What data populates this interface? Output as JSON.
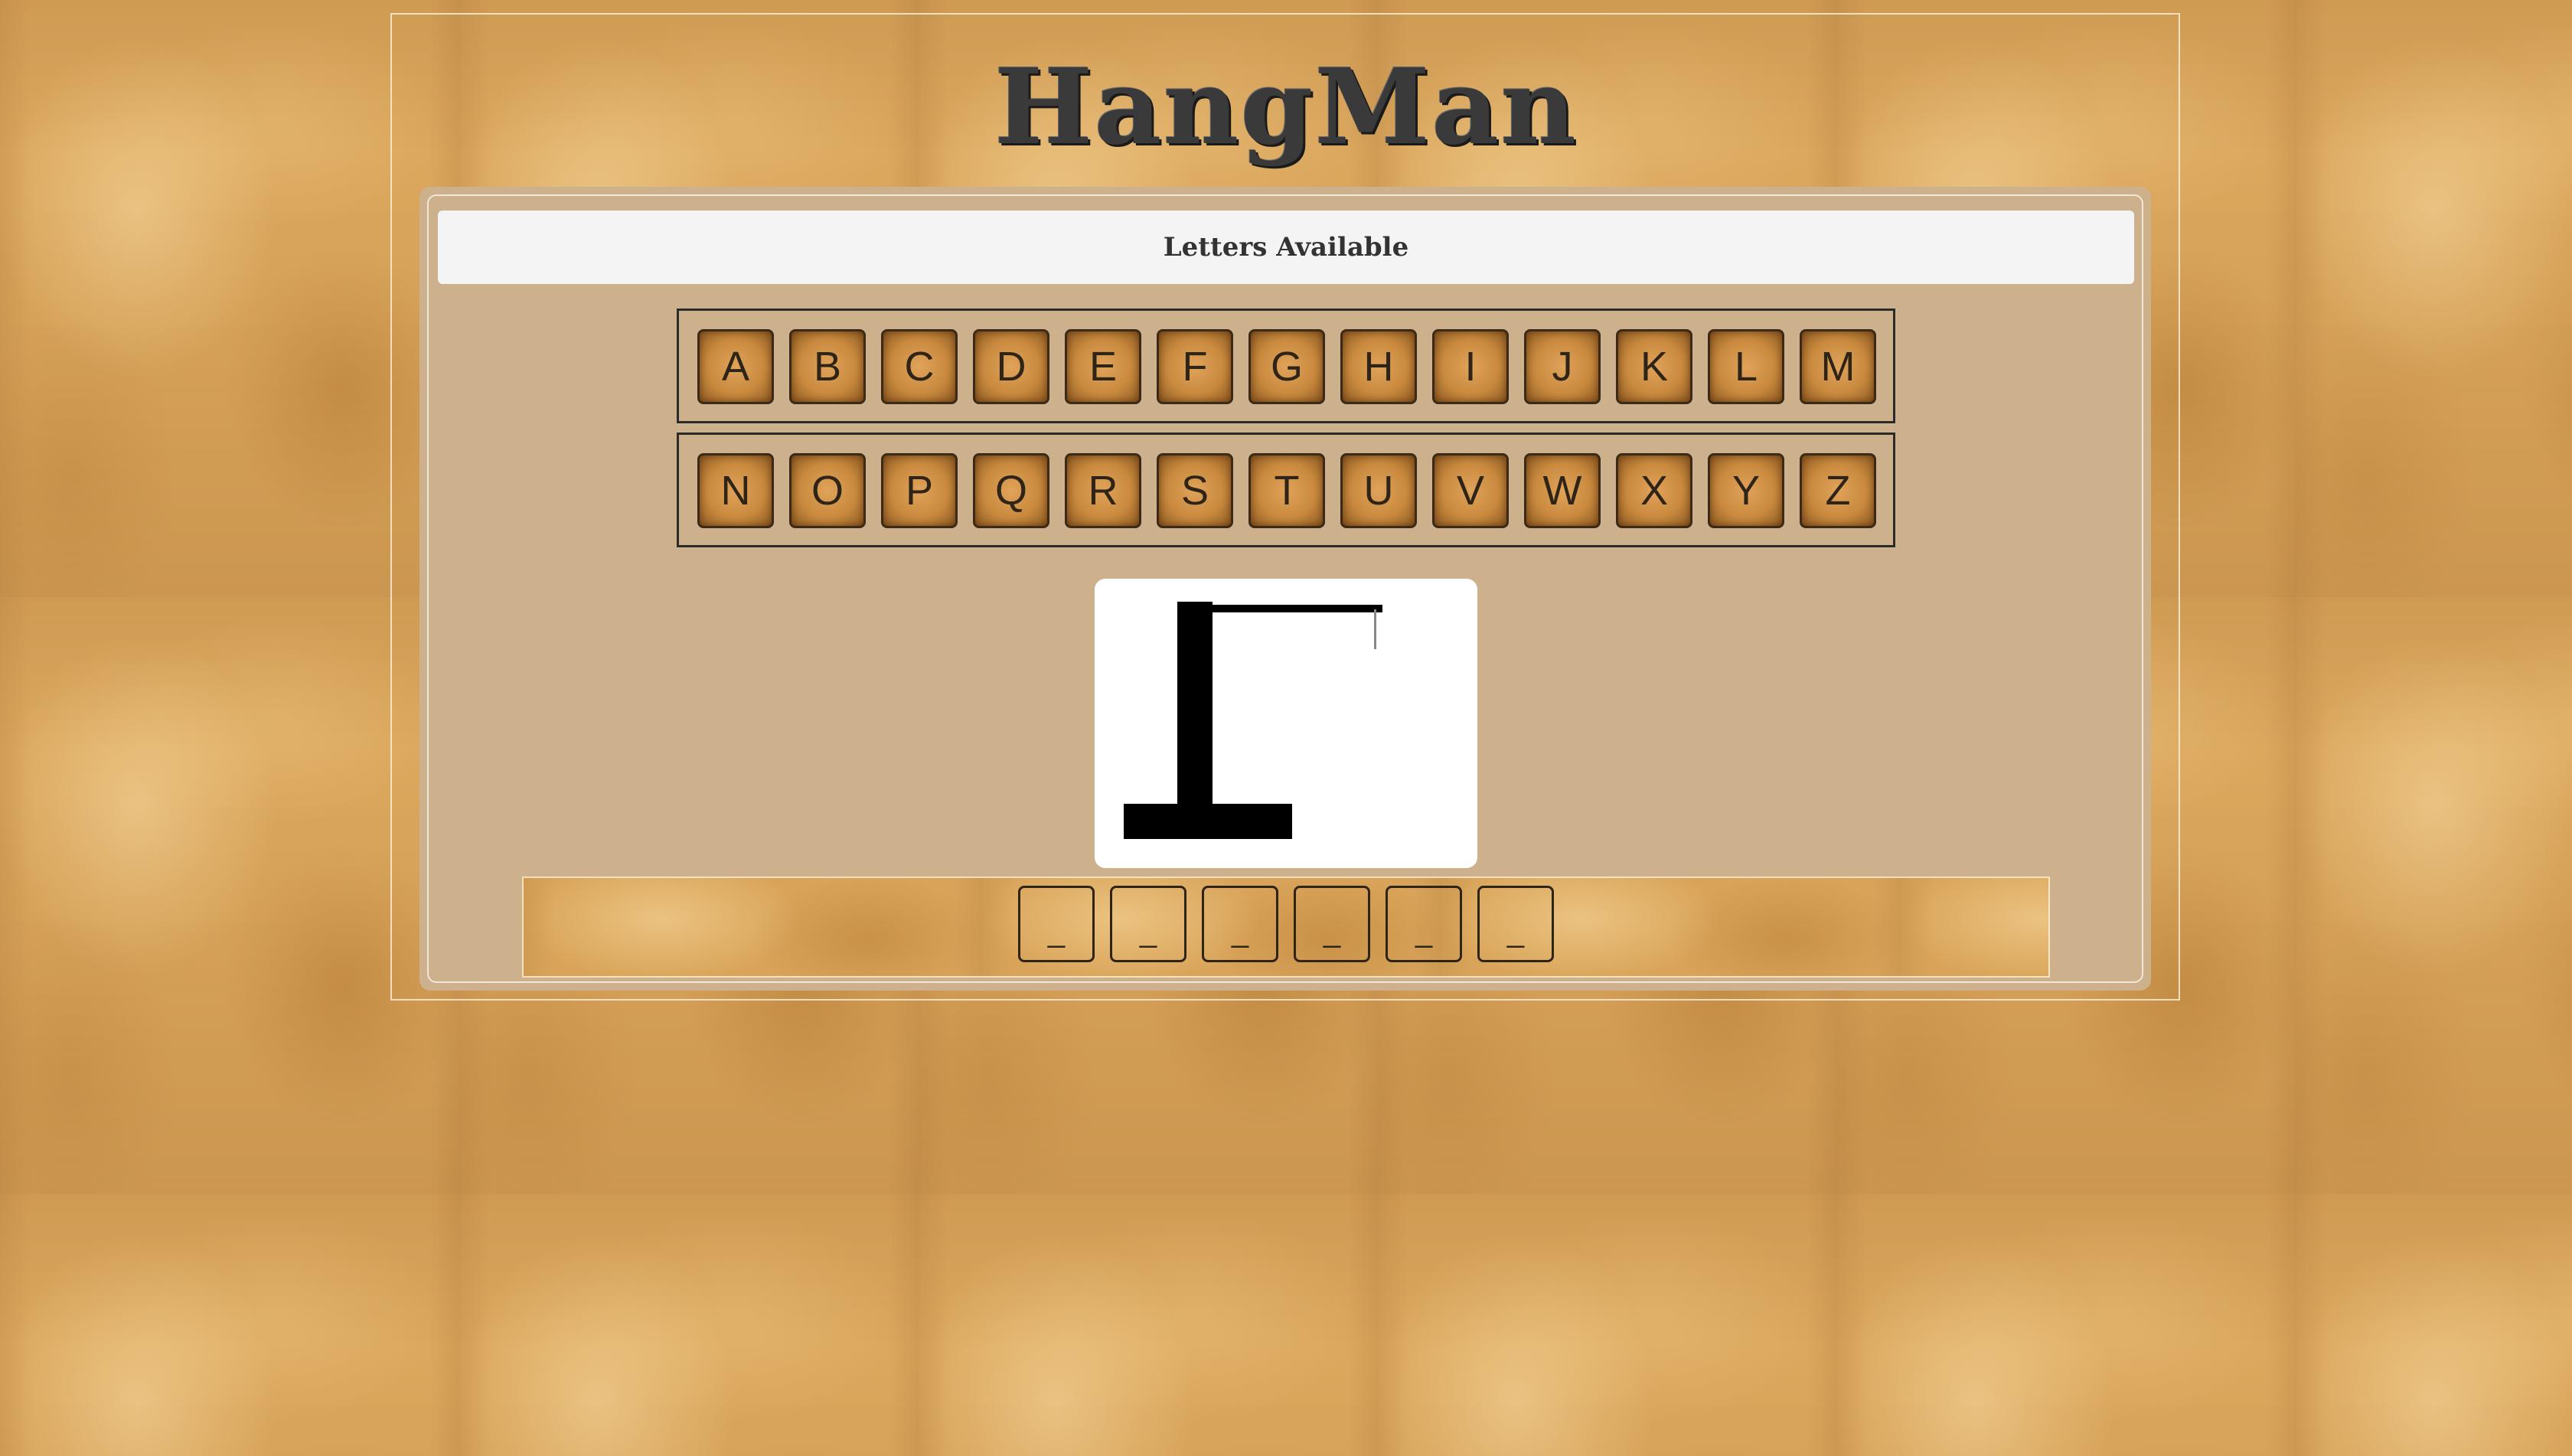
{
  "game": {
    "title": "HangMan",
    "letters_header": "Letters Available"
  },
  "letters": {
    "row1": [
      "A",
      "B",
      "C",
      "D",
      "E",
      "F",
      "G",
      "H",
      "I",
      "J",
      "K",
      "L",
      "M"
    ],
    "row2": [
      "N",
      "O",
      "P",
      "Q",
      "R",
      "S",
      "T",
      "U",
      "V",
      "W",
      "X",
      "Y",
      "Z"
    ]
  },
  "word": {
    "slots": [
      "_",
      "_",
      "_",
      "_",
      "_",
      "_"
    ]
  },
  "hangman": {
    "wrong_guesses": 0,
    "drawn_parts": [
      "base",
      "post",
      "beam",
      "rope"
    ]
  },
  "colors": {
    "title": "#3a3a3a",
    "panel": "#cdb08c",
    "tile": "#c98a3e",
    "gallows": "#000000"
  }
}
